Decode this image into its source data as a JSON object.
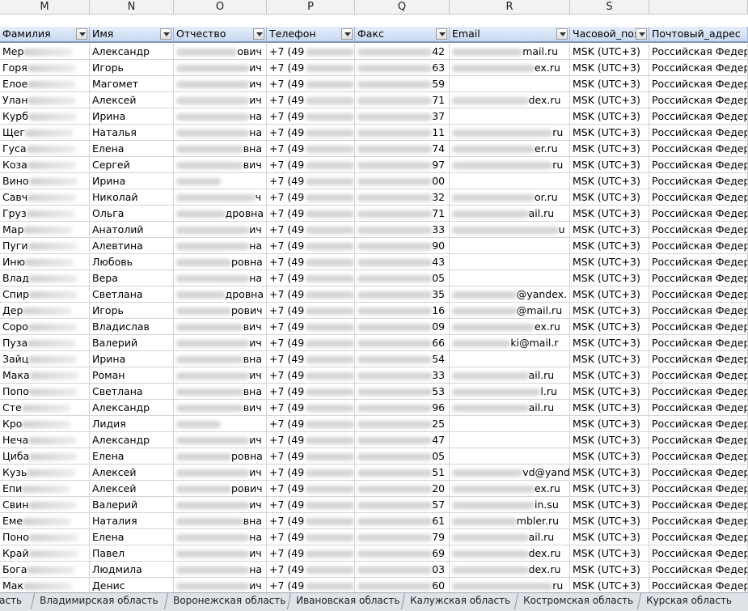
{
  "column_letters": [
    "M",
    "N",
    "O",
    "P",
    "Q",
    "R",
    "S",
    ""
  ],
  "headers": [
    "Фамилия",
    "Имя",
    "Отчество",
    "Телефон",
    "Факс",
    "Email",
    "Часовой_пояс",
    "Почтовый_адрес"
  ],
  "rows": [
    [
      "Мер",
      "Александр",
      "ович",
      "+7 (49",
      "42",
      "mail.ru",
      "MSK (UTC+3)",
      "Российская Федера"
    ],
    [
      "Горя",
      "Игорь",
      "ич",
      "+7 (49",
      "63",
      "ex.ru",
      "MSK (UTC+3)",
      "Российская Федера"
    ],
    [
      "Елое",
      "Магомет",
      "ич",
      "+7 (49",
      "59",
      "",
      "MSK (UTC+3)",
      "Российская Федера"
    ],
    [
      "Улан",
      "Алексей",
      "ич",
      "+7 (49",
      "71",
      "dex.ru",
      "MSK (UTC+3)",
      "Российская Федера"
    ],
    [
      "Курб",
      "Ирина",
      "на",
      "+7 (49",
      "37",
      "",
      "MSK (UTC+3)",
      "Российская Федера"
    ],
    [
      "Щег",
      "Наталья",
      "на",
      "+7 (49",
      "11",
      "ru",
      "MSK (UTC+3)",
      "Российская Федера"
    ],
    [
      "Гуса",
      "Елена",
      "вна",
      "+7 (49",
      "74",
      "er.ru",
      "MSK (UTC+3)",
      "Российская Федера"
    ],
    [
      "Коза",
      "Сергей",
      "вич",
      "+7 (49",
      "97",
      "ru",
      "MSK (UTC+3)",
      "Российская Федера"
    ],
    [
      "Вино",
      "Ирина",
      "",
      "+7 (49",
      "00",
      "",
      "MSK (UTC+3)",
      "Российская Федера"
    ],
    [
      "Савч",
      "Николай",
      "ч",
      "+7 (49",
      "32",
      "or.ru",
      "MSK (UTC+3)",
      "Российская Федера"
    ],
    [
      "Груз",
      "Ольга",
      "дровна",
      "+7 (49",
      "71",
      "ail.ru",
      "MSK (UTC+3)",
      "Российская Федера"
    ],
    [
      "Мар",
      "Анатолий",
      "ич",
      "+7 (49",
      "33",
      "u",
      "MSK (UTC+3)",
      "Российская Федера"
    ],
    [
      "Пуги",
      "Алевтина",
      "на",
      "+7 (49",
      "90",
      "",
      "MSK (UTC+3)",
      "Российская Федера"
    ],
    [
      "Иню",
      "Любовь",
      "ровна",
      "+7 (49",
      "43",
      "",
      "MSK (UTC+3)",
      "Российская Федера"
    ],
    [
      "Влад",
      "Вера",
      "на",
      "+7 (49",
      "05",
      "",
      "MSK (UTC+3)",
      "Российская Федера"
    ],
    [
      "Спир",
      "Светлана",
      "дровна",
      "+7 (49",
      "35",
      "@yandex.",
      "MSK (UTC+3)",
      "Российская Федера"
    ],
    [
      "Дер",
      "Игорь",
      "рович",
      "+7 (49",
      "16",
      "@mail.ru",
      "MSK (UTC+3)",
      "Российская Федера"
    ],
    [
      "Соро",
      "Владислав",
      "вич",
      "+7 (49",
      "09",
      "ex.ru",
      "MSK (UTC+3)",
      "Российская Федера"
    ],
    [
      "Пуза",
      "Валерий",
      "ич",
      "+7 (49",
      "66",
      "ki@mail.r",
      "MSK (UTC+3)",
      "Российская Федера"
    ],
    [
      "Зайц",
      "Ирина",
      "вна",
      "+7 (49",
      "54",
      "",
      "MSK (UTC+3)",
      "Российская Федера"
    ],
    [
      "Мака",
      "Роман",
      "ич",
      "+7 (49",
      "33",
      "ail.ru",
      "MSK (UTC+3)",
      "Российская Федера"
    ],
    [
      "Попо",
      "Светлана",
      "вна",
      "+7 (49",
      "53",
      "l.ru",
      "MSK (UTC+3)",
      "Российская Федера"
    ],
    [
      "Сте",
      "Александр",
      "вич",
      "+7 (49",
      "96",
      "ail.ru",
      "MSK (UTC+3)",
      "Российская Федера"
    ],
    [
      "Кро",
      "Лидия",
      "",
      "+7 (49",
      "25",
      "",
      "MSK (UTC+3)",
      "Российская Федера"
    ],
    [
      "Неча",
      "Александр",
      "ич",
      "+7 (49",
      "47",
      "",
      "MSK (UTC+3)",
      "Российская Федера"
    ],
    [
      "Циба",
      "Елена",
      "ровна",
      "+7 (49",
      "05",
      "",
      "MSK (UTC+3)",
      "Российская Федера"
    ],
    [
      "Кузь",
      "Алексей",
      "ич",
      "+7 (49",
      "51",
      "vd@yand",
      "MSK (UTC+3)",
      "Российская Федера"
    ],
    [
      "Епи",
      "Алексей",
      "рович",
      "+7 (49",
      "20",
      "ex.ru",
      "MSK (UTC+3)",
      "Российская Федера"
    ],
    [
      "Свин",
      "Валерий",
      "ич",
      "+7 (49",
      "57",
      "in.su",
      "MSK (UTC+3)",
      "Российская Федера"
    ],
    [
      "Еме",
      "Наталия",
      "вна",
      "+7 (49",
      "61",
      "mbler.ru",
      "MSK (UTC+3)",
      "Российская Федера"
    ],
    [
      "Поно",
      "Елена",
      "на",
      "+7 (49",
      "79",
      "ail.ru",
      "MSK (UTC+3)",
      "Российская Федера"
    ],
    [
      "Край",
      "Павел",
      "ич",
      "+7 (49",
      "69",
      "dex.ru",
      "MSK (UTC+3)",
      "Российская Федера"
    ],
    [
      "Бога",
      "Людмила",
      "на",
      "+7 (49",
      "03",
      "dex.ru",
      "MSK (UTC+3)",
      "Российская Федера"
    ],
    [
      "Мак",
      "Денис",
      "ич",
      "+7 (49",
      "60",
      "ru",
      "MSK (UTC+3)",
      "Российская Федера"
    ]
  ],
  "sheet_tabs": [
    "асть",
    "Владимирская область",
    "Воронежская область",
    "Ивановская область",
    "Калужская область",
    "Костромская область",
    "Курская область"
  ]
}
